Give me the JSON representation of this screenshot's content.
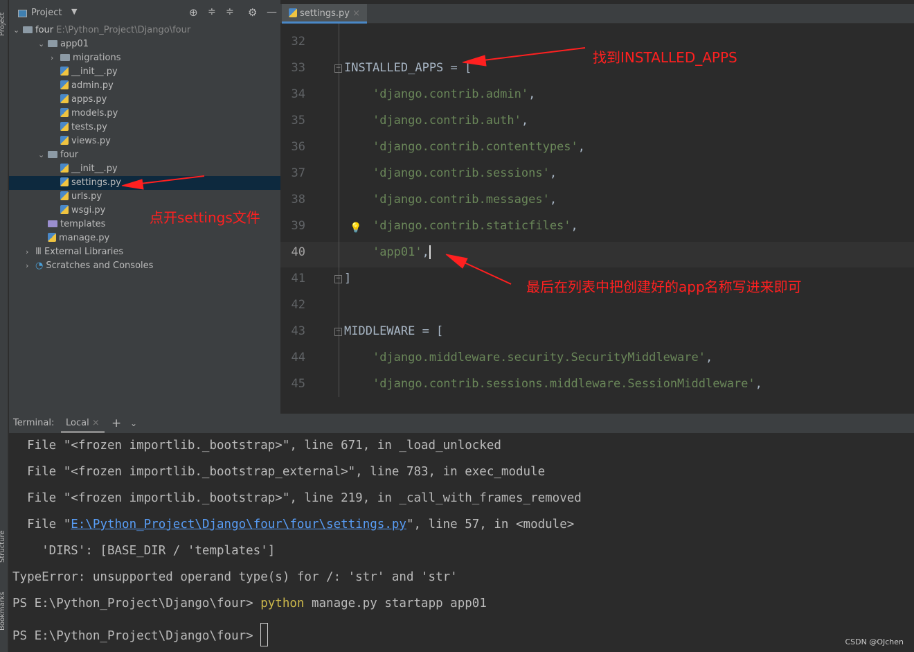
{
  "side_strip": {
    "project": "Project",
    "structure": "Structure",
    "bookmarks": "Bookmarks"
  },
  "sidebar": {
    "title": "Project",
    "root": {
      "name": "four",
      "path": "E:\\Python_Project\\Django\\four"
    },
    "items": [
      {
        "label": "app01",
        "type": "folder",
        "depth": 1,
        "expanded": true
      },
      {
        "label": "migrations",
        "type": "folder",
        "depth": 2,
        "expanded": false
      },
      {
        "label": "__init__.py",
        "type": "py",
        "depth": 2
      },
      {
        "label": "admin.py",
        "type": "py",
        "depth": 2
      },
      {
        "label": "apps.py",
        "type": "py",
        "depth": 2
      },
      {
        "label": "models.py",
        "type": "py",
        "depth": 2
      },
      {
        "label": "tests.py",
        "type": "py",
        "depth": 2
      },
      {
        "label": "views.py",
        "type": "py",
        "depth": 2
      },
      {
        "label": "four",
        "type": "folder",
        "depth": 1,
        "expanded": true
      },
      {
        "label": "__init__.py",
        "type": "py",
        "depth": 2
      },
      {
        "label": "settings.py",
        "type": "py",
        "depth": 2,
        "selected": true
      },
      {
        "label": "urls.py",
        "type": "py",
        "depth": 2
      },
      {
        "label": "wsgi.py",
        "type": "py",
        "depth": 2
      },
      {
        "label": "templates",
        "type": "folder",
        "depth": 1
      },
      {
        "label": "manage.py",
        "type": "py",
        "depth": 1
      },
      {
        "label": "External Libraries",
        "type": "lib",
        "depth": 0
      },
      {
        "label": "Scratches and Consoles",
        "type": "scratch",
        "depth": 0
      }
    ]
  },
  "editor": {
    "tab": "settings.py",
    "lines": [
      {
        "n": "32",
        "code": ""
      },
      {
        "n": "33",
        "code": "INSTALLED_APPS = ["
      },
      {
        "n": "34",
        "str": "'django.contrib.admin'"
      },
      {
        "n": "35",
        "str": "'django.contrib.auth'"
      },
      {
        "n": "36",
        "str": "'django.contrib.contenttypes'"
      },
      {
        "n": "37",
        "str": "'django.contrib.sessions'"
      },
      {
        "n": "38",
        "str": "'django.contrib.messages'"
      },
      {
        "n": "39",
        "str": "'django.contrib.staticfiles'"
      },
      {
        "n": "40",
        "str": "'app01'"
      },
      {
        "n": "41",
        "code": "]"
      },
      {
        "n": "42",
        "code": ""
      },
      {
        "n": "43",
        "code": "MIDDLEWARE = ["
      },
      {
        "n": "44",
        "str": "'django.middleware.security.SecurityMiddleware'"
      },
      {
        "n": "45",
        "str": "'django.contrib.sessions.middleware.SessionMiddleware'"
      }
    ]
  },
  "terminal": {
    "label": "Terminal:",
    "tab": "Local",
    "lines": [
      "  File \"<frozen importlib._bootstrap>\", line 671, in _load_unlocked",
      "  File \"<frozen importlib._bootstrap_external>\", line 783, in exec_module",
      "  File \"<frozen importlib._bootstrap>\", line 219, in _call_with_frames_removed"
    ],
    "file_line": {
      "pre": "  File \"",
      "link": "E:\\Python_Project\\Django\\four\\four\\settings.py",
      "post": "\", line 57, in <module>"
    },
    "dirs_line": "    'DIRS': [BASE_DIR / 'templates']",
    "error": "TypeError: unsupported operand type(s) for /: 'str' and 'str'",
    "prompt": "PS E:\\Python_Project\\Django\\four> ",
    "cmd_kw": "python",
    "cmd_rest": " manage.py startapp app01"
  },
  "annotations": {
    "a1": "找到INSTALLED_APPS",
    "a2": "点开settings文件",
    "a3": "最后在列表中把创建好的app名称写进来即可",
    "color": "#ff2020"
  },
  "watermark": "CSDN @OJchen"
}
